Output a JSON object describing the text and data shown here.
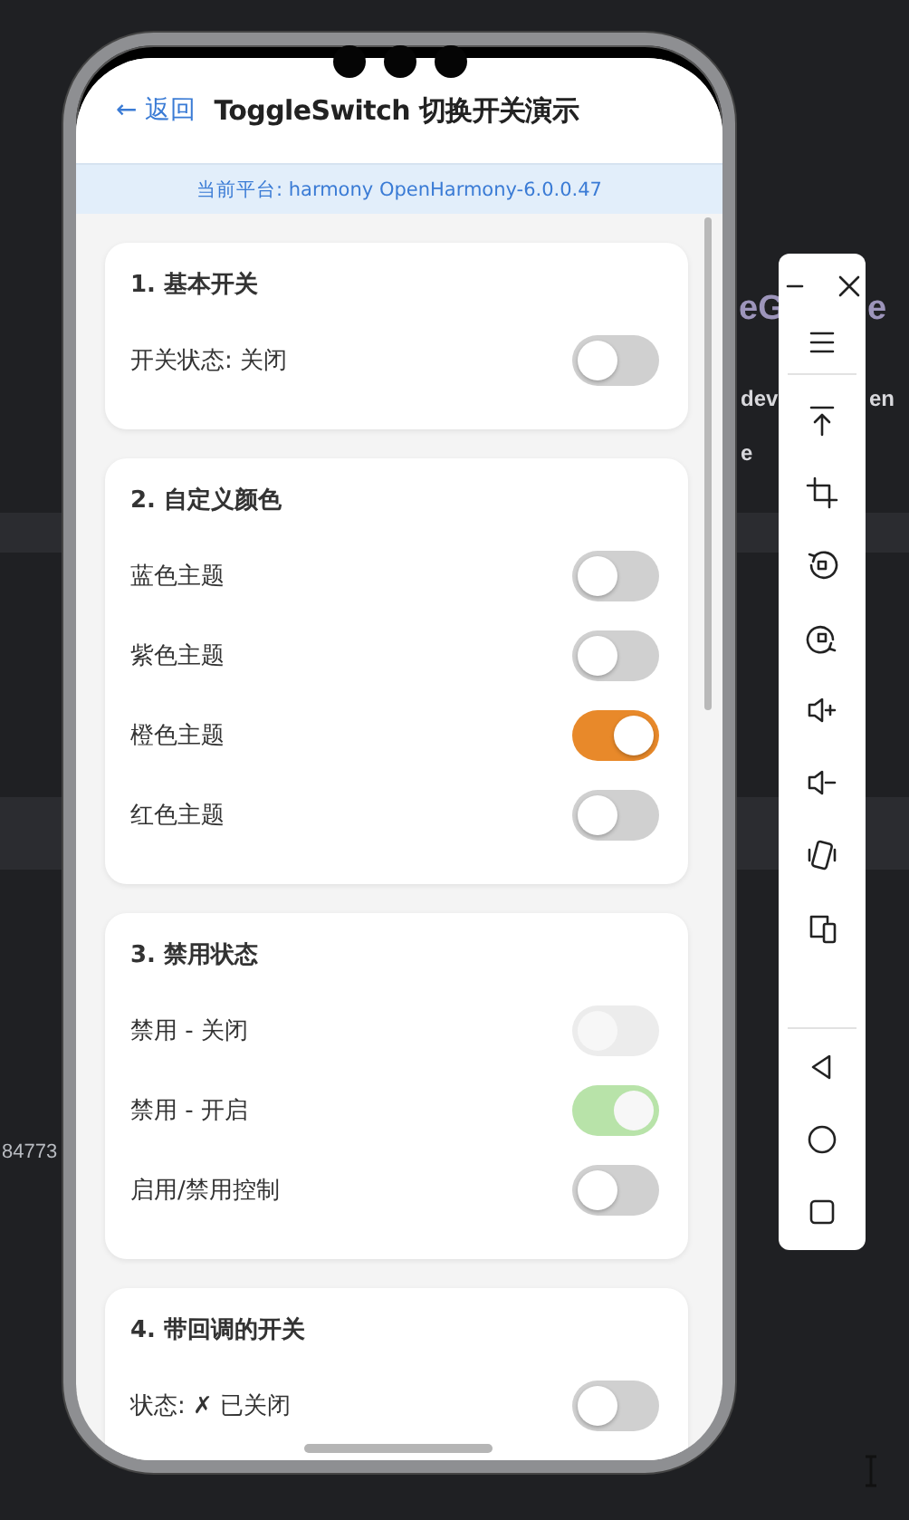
{
  "header": {
    "back": "← 返回",
    "title": "ToggleSwitch 切换开关演示"
  },
  "platform_banner": "当前平台: harmony OpenHarmony-6.0.0.47",
  "sections": [
    {
      "title": "1. 基本开关",
      "rows": [
        {
          "label": "开关状态: 关闭",
          "on": false,
          "disabled": false
        }
      ]
    },
    {
      "title": "2. 自定义颜色",
      "rows": [
        {
          "label": "蓝色主题",
          "on": false,
          "disabled": false
        },
        {
          "label": "紫色主题",
          "on": false,
          "disabled": false
        },
        {
          "label": "橙色主题",
          "on": true,
          "disabled": false,
          "color": "#e8892a"
        },
        {
          "label": "红色主题",
          "on": false,
          "disabled": false
        }
      ]
    },
    {
      "title": "3. 禁用状态",
      "rows": [
        {
          "label": "禁用 - 关闭",
          "on": false,
          "disabled": true
        },
        {
          "label": "禁用 - 开启",
          "on": true,
          "disabled": true,
          "color": "#b8e3a9"
        },
        {
          "label": "启用/禁用控制",
          "on": false,
          "disabled": false
        }
      ]
    },
    {
      "title": "4. 带回调的开关",
      "rows": [
        {
          "label": "状态: ✗ 已关闭",
          "on": false,
          "disabled": false
        }
      ]
    }
  ],
  "background_text": [
    "eG",
    "e",
    "dev",
    "en",
    "e",
    "84773"
  ]
}
